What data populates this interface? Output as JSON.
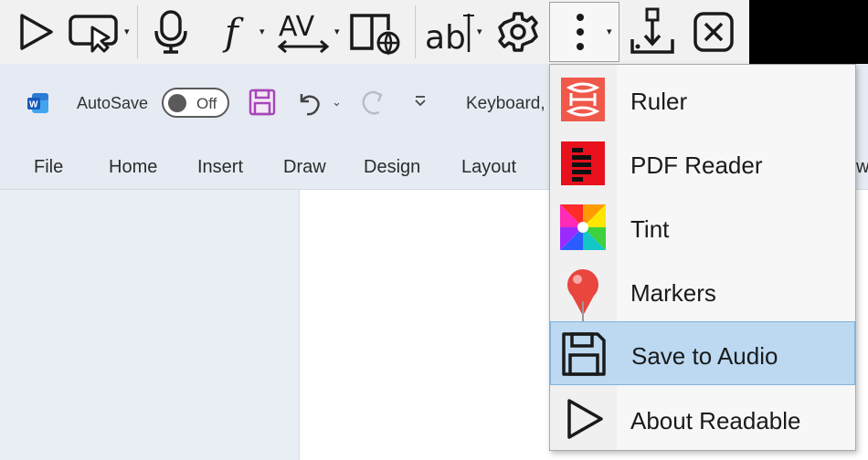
{
  "readable_toolbar": {
    "tools": [
      "play-icon",
      "select-play-icon",
      "microphone-icon",
      "math-f-icon",
      "spacing-av-icon",
      "dictionary-globe-icon",
      "text-ab-icon",
      "settings-gear-icon",
      "more-vertical-icon",
      "download-audio-icon",
      "close-icon"
    ],
    "more_menu": [
      {
        "label": "Ruler",
        "icon": "ruler-icon"
      },
      {
        "label": "PDF Reader",
        "icon": "pdf-reader-icon"
      },
      {
        "label": "Tint",
        "icon": "tint-icon"
      },
      {
        "label": "Markers",
        "icon": "marker-pin-icon"
      },
      {
        "label": "Save to Audio",
        "icon": "floppy-disk-icon"
      },
      {
        "label": "About Readable",
        "icon": "play-outline-icon"
      }
    ]
  },
  "word": {
    "logo": "W",
    "autosave_label": "AutoSave",
    "autosave_state": "Off",
    "doc_title": "Keyboard,",
    "tabs": [
      "File",
      "Home",
      "Insert",
      "Draw",
      "Design",
      "Layout"
    ],
    "tab_partial": "w"
  },
  "colors": {
    "selection": "#bcd9f1",
    "ribbon_bg": "#e6ebf3",
    "ruler_red": "#f0584a",
    "pdf_red": "#e8101c",
    "marker_red": "#e8463e"
  }
}
